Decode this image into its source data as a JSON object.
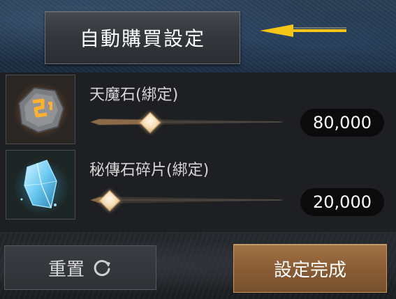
{
  "header": {
    "title_button": "自動購買設定"
  },
  "items": [
    {
      "name": "天魔石(綁定)",
      "value": "80,000",
      "slider_fraction": 0.3,
      "icon": "demon-stone-icon"
    },
    {
      "name": "秘傳石碎片(綁定)",
      "value": "20,000",
      "slider_fraction": 0.08,
      "icon": "secret-stone-shard-icon"
    }
  ],
  "footer": {
    "reset_label": "重置",
    "confirm_label": "設定完成"
  },
  "colors": {
    "arrow": "#f5c518",
    "confirm_button": "#8a5d35",
    "slider_handle": "#f4dcb4"
  }
}
